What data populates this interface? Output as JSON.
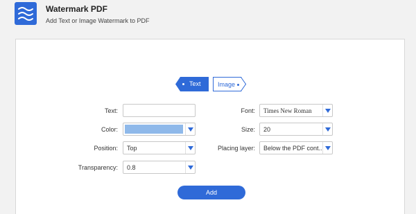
{
  "app": {
    "title": "Watermark PDF",
    "subtitle": "Add Text or Image Watermark to PDF",
    "icon": "waves-icon",
    "accent": "#2f6ad8"
  },
  "tabs": [
    {
      "label": "Text",
      "active": true
    },
    {
      "label": "Image",
      "active": false
    }
  ],
  "form": {
    "text_label": "Text:",
    "text_value": "",
    "color_label": "Color:",
    "color_value": "#8fb9ea",
    "position_label": "Position:",
    "position_value": "Top",
    "transparency_label": "Transparency:",
    "transparency_value": "0.8",
    "font_label": "Font:",
    "font_value": "Times New Roman",
    "size_label": "Size:",
    "size_value": "20",
    "layer_label": "Placing layer:",
    "layer_value": "Below the PDF cont..."
  },
  "add_button": "Add"
}
